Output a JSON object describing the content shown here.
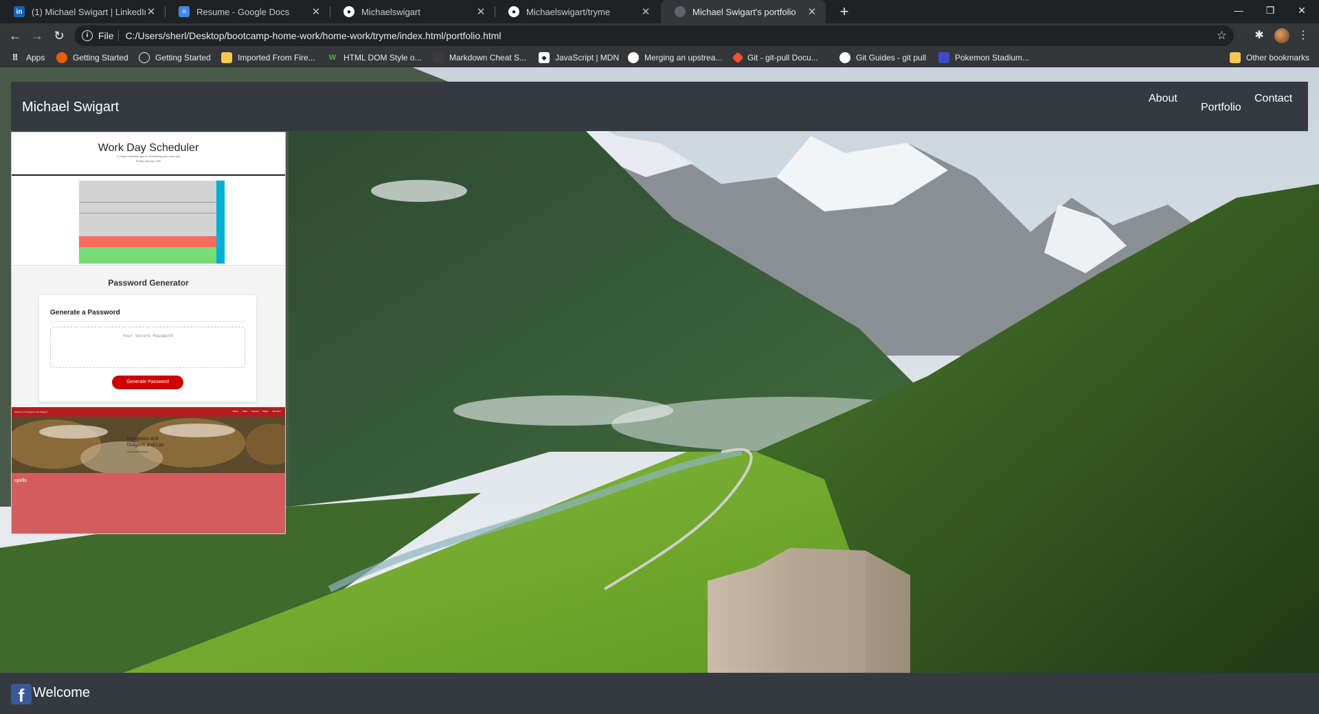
{
  "browser": {
    "tabs": [
      {
        "title": "(1) Michael Swigart | LinkedIn",
        "icon": "linkedin-icon",
        "color": "#0a66c2",
        "glyph": "in"
      },
      {
        "title": "Resume - Google Docs",
        "icon": "google-docs-icon",
        "color": "#4285f4",
        "glyph": "≡"
      },
      {
        "title": "Michaelswigart",
        "icon": "github-icon",
        "color": "#ffffff",
        "glyph": "●"
      },
      {
        "title": "Michaelswigart/tryme",
        "icon": "github-icon",
        "color": "#ffffff",
        "glyph": "●"
      },
      {
        "title": "Michael Swigart's portfolio",
        "icon": "globe-icon",
        "color": "#9aa0a6",
        "glyph": "◍",
        "active": true
      }
    ],
    "address": {
      "scheme": "File",
      "url": "C:/Users/sherl/Desktop/bootcamp-home-work/home-work/tryme/index.html/portfolio.html"
    },
    "bookmarks": [
      {
        "label": "Apps",
        "icon": "apps-grid-icon"
      },
      {
        "label": "Getting Started",
        "icon": "firefox-icon"
      },
      {
        "label": "Getting Started",
        "icon": "globe-icon"
      },
      {
        "label": "Imported From Fire...",
        "icon": "folder-icon"
      },
      {
        "label": "HTML DOM Style o...",
        "icon": "w3schools-icon"
      },
      {
        "label": "Markdown Cheat S...",
        "icon": "markdown-icon"
      },
      {
        "label": "JavaScript | MDN",
        "icon": "mdn-icon"
      },
      {
        "label": "Merging an upstrea...",
        "icon": "github-icon"
      },
      {
        "label": "Git - git-pull Docu...",
        "icon": "git-icon"
      },
      {
        "label": "Git Guides - git pull",
        "icon": "github-icon"
      },
      {
        "label": "Pokemon Stadium...",
        "icon": "pokemon-icon"
      },
      {
        "label": "Other bookmarks",
        "icon": "folder-icon"
      }
    ]
  },
  "site": {
    "brand": "Michael Swigart",
    "nav": {
      "about": "About",
      "portfolio": "Portfolio",
      "contact": "Contact"
    },
    "footer": {
      "welcome": "Welcome",
      "icon": "facebook-icon"
    }
  },
  "portfolio": {
    "scheduler": {
      "title": "Work Day Scheduler",
      "subtitle": "A simple calendar app for scheduling your work day",
      "date": "Friday, January 15th"
    },
    "password": {
      "heading": "Password Generator",
      "card_title": "Generate a Password",
      "placeholder": "Your Secure Password",
      "button": "Generate Password"
    },
    "dnd": {
      "brand": "Welcome to Dungeons and Dragons",
      "links": [
        "Races",
        "Skills",
        "Classes",
        "Magic",
        "Monsters"
      ],
      "hero": "Dungeons and Dragons and Lair",
      "hero_sub": "An Inspirational Project",
      "spells": "spells"
    }
  },
  "colors": {
    "navbar": "#343a40",
    "scheduler_past": "#d3d3d3",
    "scheduler_present": "#ff6961",
    "scheduler_future": "#77dd77",
    "scheduler_save": "#06aed5",
    "password_button": "#cc0000",
    "dnd_bar": "#b51d1d",
    "dnd_body": "#d35d5d"
  }
}
